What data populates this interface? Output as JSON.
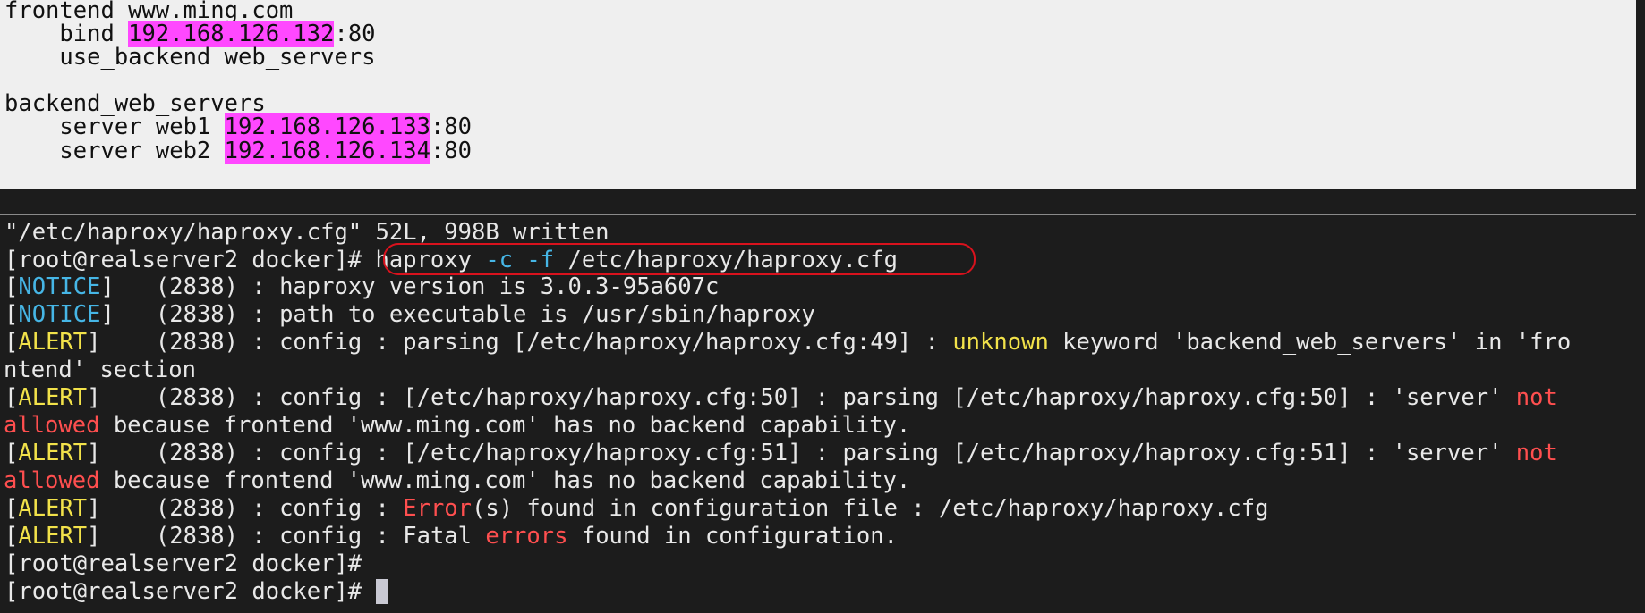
{
  "editor": {
    "lines": [
      {
        "text": "frontend www.ming.com"
      },
      {
        "pre": "    bind ",
        "hl": "192.168.126.132",
        "post": ":80"
      },
      {
        "text": "    use_backend web_servers"
      },
      {
        "text": ""
      },
      {
        "text": "backend_web_servers"
      },
      {
        "pre": "    server web1 ",
        "hl": "192.168.126.133",
        "post": ":80"
      },
      {
        "pre": "    server web2 ",
        "hl": "192.168.126.134",
        "post": ":80"
      }
    ]
  },
  "terminal": {
    "write_status": "\"/etc/haproxy/haproxy.cfg\" 52L, 998B written",
    "prompt": "[root@realserver2 docker]# ",
    "command": {
      "name": "haproxy",
      "flag_c": "-c",
      "flag_f": "-f",
      "path": "/etc/haproxy/haproxy.cfg"
    },
    "notice_tag": "NOTICE",
    "alert_tag": "ALERT",
    "notice_1": "   (2838) : haproxy version is 3.0.3-95a607c",
    "notice_2": "   (2838) : path to executable is /usr/sbin/haproxy",
    "alert_1": {
      "pre": "    (2838) : config : parsing [/etc/haproxy/haproxy.cfg:49] : ",
      "word": "unknown",
      "post": " keyword 'backend_web_servers' in 'fro",
      "wrap": "ntend' section"
    },
    "alert_2": {
      "pre": "    (2838) : config : [/etc/haproxy/haproxy.cfg:50] : parsing [/etc/haproxy/haproxy.cfg:50] : 'server' ",
      "word_a": "not",
      "word_b": "allowed",
      "post": " because frontend 'www.ming.com' has no backend capability."
    },
    "alert_3": {
      "pre": "    (2838) : config : [/etc/haproxy/haproxy.cfg:51] : parsing [/etc/haproxy/haproxy.cfg:51] : 'server' ",
      "word_a": "not",
      "word_b": "allowed",
      "post": " because frontend 'www.ming.com' has no backend capability."
    },
    "alert_4": {
      "pre": "    (2838) : config : ",
      "word": "Error",
      "post": "(s) found in configuration file : /etc/haproxy/haproxy.cfg"
    },
    "alert_5": {
      "pre": "    (2838) : config : Fatal ",
      "word": "errors",
      "post": " found in configuration."
    }
  },
  "colors": {
    "terminal_bg": "#1c1c1c",
    "editor_bg": "#efefef",
    "ip_highlight": "#ff48ff",
    "tag_cyan": "#46b6e6",
    "tag_yellow": "#f2e24a",
    "error_red": "#ff4f4f",
    "annotation_red": "#d9121d"
  }
}
